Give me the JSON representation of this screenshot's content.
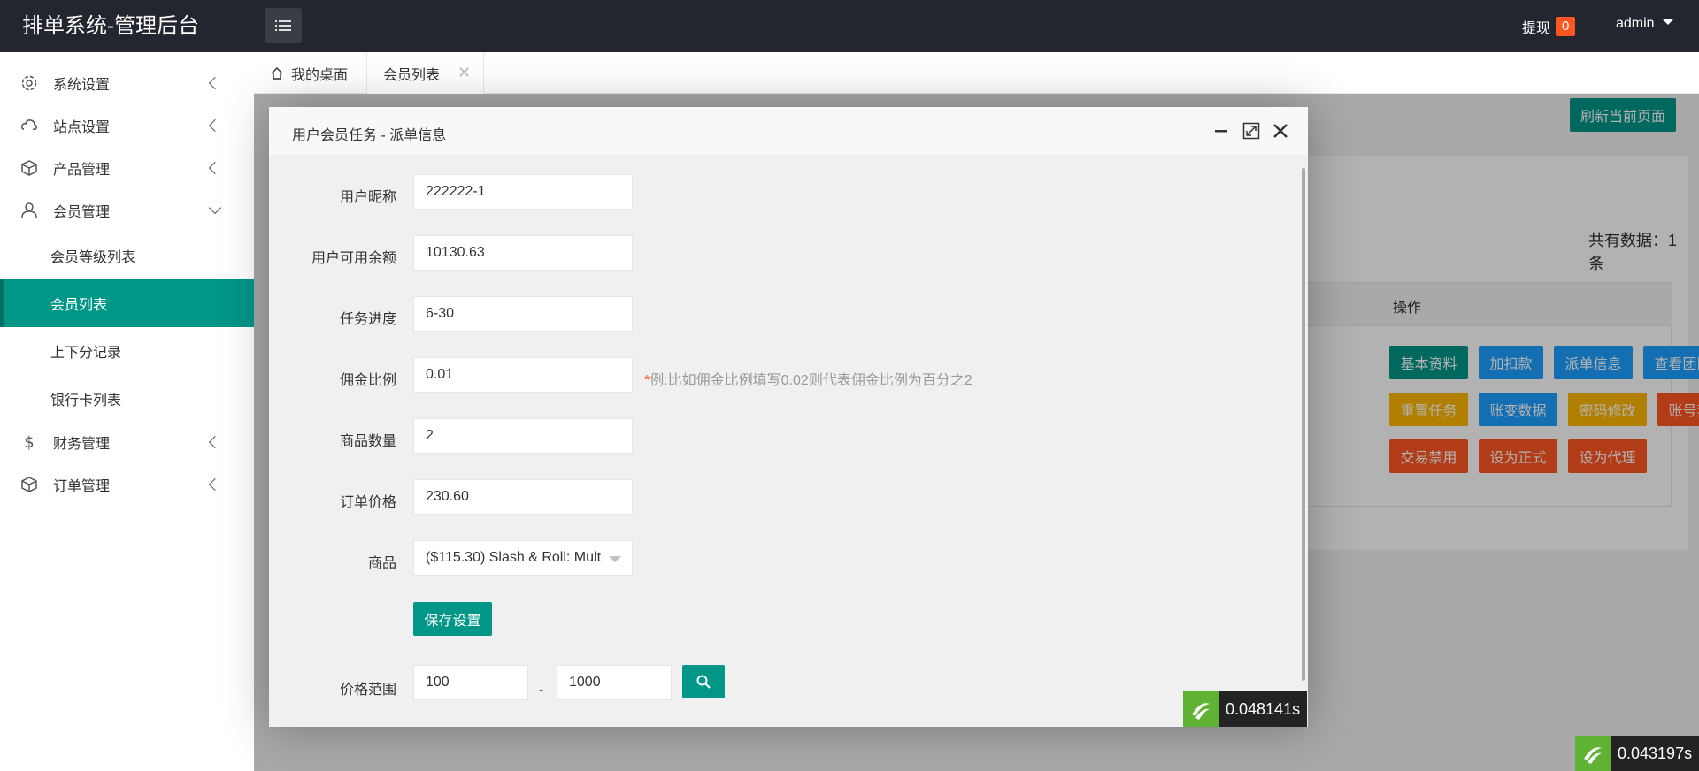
{
  "app": {
    "title": "排单系统-管理后台"
  },
  "header": {
    "withdraw_label": "提现",
    "withdraw_count": "0",
    "username": "admin"
  },
  "sidebar": {
    "items": [
      {
        "label": "系统设置",
        "icon": "gear-icon"
      },
      {
        "label": "站点设置",
        "icon": "cloud-icon"
      },
      {
        "label": "产品管理",
        "icon": "box-icon"
      },
      {
        "label": "会员管理",
        "icon": "user-icon"
      },
      {
        "label": "财务管理",
        "icon": "dollar-icon"
      },
      {
        "label": "订单管理",
        "icon": "box-icon"
      }
    ],
    "subitems": [
      {
        "label": "会员等级列表"
      },
      {
        "label": "会员列表"
      },
      {
        "label": "上下分记录"
      },
      {
        "label": "银行卡列表"
      }
    ]
  },
  "tabs": [
    {
      "label": "我的桌面"
    },
    {
      "label": "会员列表"
    }
  ],
  "page": {
    "refresh_label": "刷新当前页面",
    "total_label": "共有数据：1 条",
    "op_header": "操作",
    "actions": [
      {
        "label": "基本资料",
        "color": "#009688"
      },
      {
        "label": "加扣款",
        "color": "#1e9fff"
      },
      {
        "label": "派单信息",
        "color": "#1e9fff"
      },
      {
        "label": "查看团队",
        "color": "#1e9fff"
      },
      {
        "label": "重置任务",
        "color": "#ffb800"
      },
      {
        "label": "账变数据",
        "color": "#1e9fff"
      },
      {
        "label": "密码修改",
        "color": "#ffb800"
      },
      {
        "label": "账号禁用",
        "color": "#ff5722"
      },
      {
        "label": "交易禁用",
        "color": "#ff5722"
      },
      {
        "label": "设为正式",
        "color": "#ff5722"
      },
      {
        "label": "设为代理",
        "color": "#ff5722"
      }
    ],
    "timer": "0.043197s"
  },
  "modal": {
    "title": "用户会员任务 - 派单信息",
    "fields": [
      {
        "label": "用户昵称",
        "value": "222222-1"
      },
      {
        "label": "用户可用余额",
        "value": "10130.63"
      },
      {
        "label": "任务进度",
        "value": "6-30"
      },
      {
        "label": "佣金比例",
        "value": "0.01"
      },
      {
        "label": "商品数量",
        "value": "2"
      },
      {
        "label": "订单价格",
        "value": "230.60"
      },
      {
        "label": "商品",
        "value": "($115.30) Slash & Roll: Mult"
      }
    ],
    "commission_hint_star": "*",
    "commission_hint": "例:比如佣金比例填写0.02则代表佣金比例为百分之2",
    "save_label": "保存设置",
    "price_range_label": "价格范围",
    "price_min": "100",
    "price_max": "1000",
    "range_sep": "-",
    "timer": "0.048141s"
  }
}
